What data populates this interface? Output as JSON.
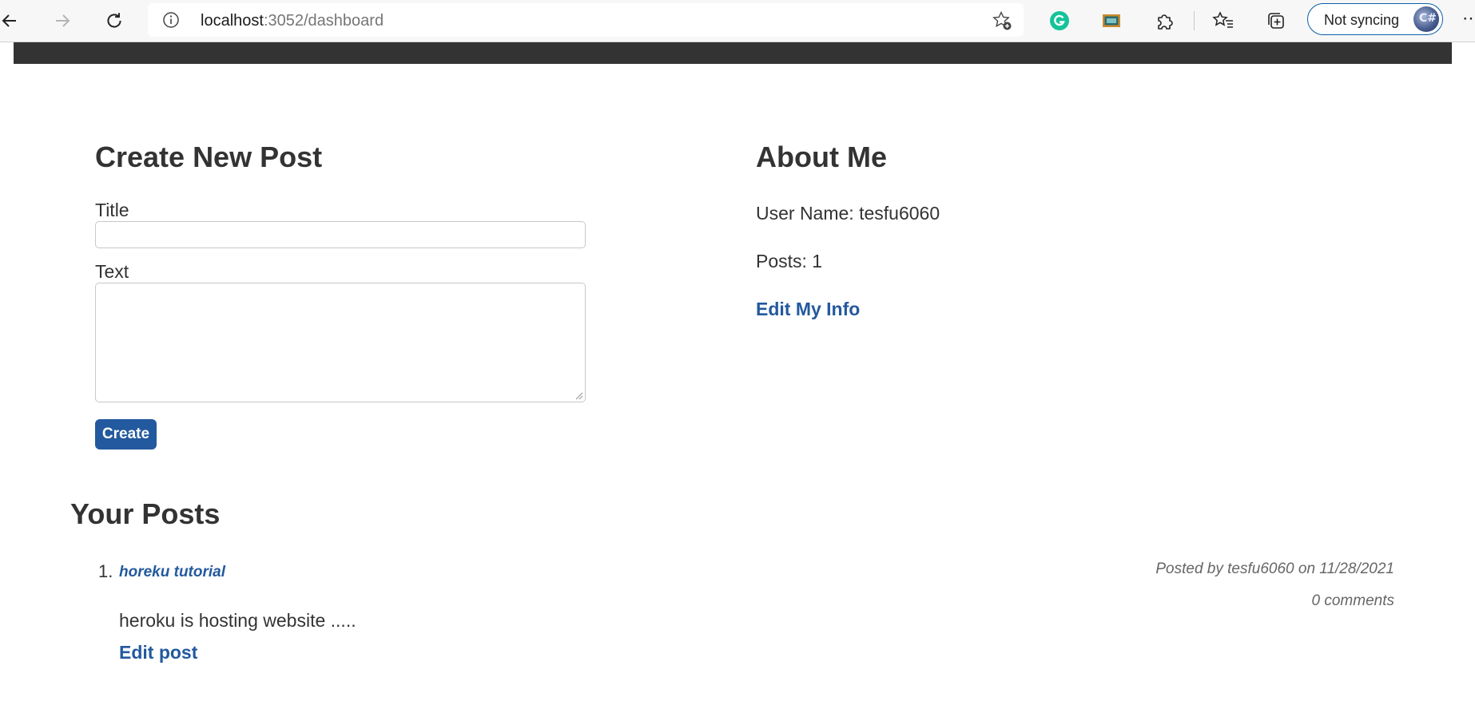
{
  "browser": {
    "url_host": "localhost",
    "url_path": ":3052/dashboard",
    "profile_label": "Not syncing",
    "profile_avatar_text": "C#",
    "icons": [
      "back-icon",
      "forward-icon",
      "refresh-icon",
      "info-icon",
      "add-favorite-icon",
      "grammarly-icon",
      "extension-screen-icon",
      "extensions-puzzle-icon",
      "favorites-icon",
      "collections-icon",
      "more-icon"
    ],
    "more_label": "⋯"
  },
  "create_post": {
    "heading": "Create New Post",
    "title_label": "Title",
    "title_value": "",
    "text_label": "Text",
    "text_value": "",
    "submit_label": "Create"
  },
  "about": {
    "heading": "About Me",
    "user_line": "User Name: tesfu6060",
    "posts_line": "Posts: 1",
    "edit_link": "Edit My Info"
  },
  "your_posts": {
    "heading": "Your Posts",
    "items": [
      {
        "number": "1.",
        "title": "horeku tutorial",
        "byline": "Posted by tesfu6060 on 11/28/2021",
        "comments": "0 comments",
        "body": "heroku is hosting website .....",
        "edit_label": "Edit post"
      }
    ]
  },
  "colors": {
    "navbar": "#333333",
    "accent": "#23599e",
    "text": "#333333"
  }
}
